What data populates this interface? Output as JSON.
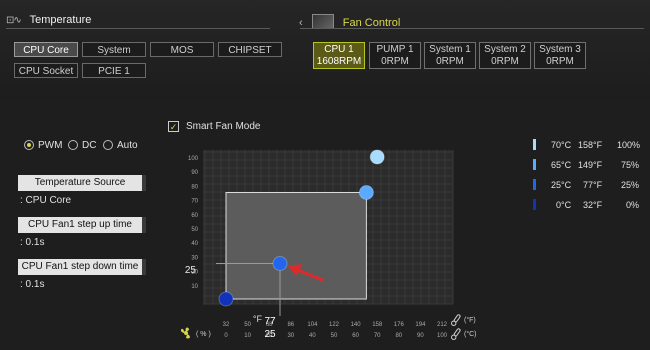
{
  "header": {
    "left_title": "Temperature",
    "left_icon": "temperature-monitor-icon",
    "right_title": "Fan Control",
    "right_icon": "fan-control-icon"
  },
  "sensors": [
    "CPU Core",
    "System",
    "MOS",
    "CHIPSET",
    "CPU Socket",
    "PCIE 1"
  ],
  "selected_sensor": "CPU Core",
  "fans": [
    {
      "name": "CPU 1",
      "rpm": "1608RPM"
    },
    {
      "name": "PUMP 1",
      "rpm": "0RPM"
    },
    {
      "name": "System 1",
      "rpm": "0RPM"
    },
    {
      "name": "System 2",
      "rpm": "0RPM"
    },
    {
      "name": "System 3",
      "rpm": "0RPM"
    }
  ],
  "selected_fan": "CPU 1",
  "mode_options": [
    "PWM",
    "DC",
    "Auto"
  ],
  "selected_mode": "PWM",
  "settings": {
    "temp_source_label": "Temperature Source",
    "temp_source_value": ": CPU Core",
    "step_up_label": "CPU Fan1 step up time",
    "step_up_value": ": 0.1s",
    "step_down_label": "CPU Fan1 step down time",
    "step_down_value": ": 0.1s"
  },
  "smart_fan": {
    "label": "Smart Fan Mode",
    "checked": true,
    "check_mark": "✓"
  },
  "legend": [
    {
      "c": "70°C",
      "f": "158°F",
      "pct": "100%",
      "color": "#a8dcff"
    },
    {
      "c": "65°C",
      "f": "149°F",
      "pct": "75%",
      "color": "#5aaaff"
    },
    {
      "c": "25°C",
      "f": "77°F",
      "pct": "25%",
      "color": "#2266ee"
    },
    {
      "c": "0°C",
      "f": "32°F",
      "pct": "0%",
      "color": "#1133bb"
    }
  ],
  "graph": {
    "y_ticks": [
      "100",
      "90",
      "80",
      "70",
      "60",
      "50",
      "40",
      "30",
      "20",
      "10"
    ],
    "f_ticks": [
      "32",
      "50",
      "68",
      "86",
      "104",
      "122",
      "140",
      "158",
      "176",
      "194",
      "212"
    ],
    "c_ticks": [
      "0",
      "10",
      "20",
      "30",
      "40",
      "50",
      "60",
      "70",
      "80",
      "90",
      "100"
    ],
    "f_unit": "(°F)",
    "c_unit": "(°C)",
    "pct_unit": "( % )",
    "highlight_temp_f": "77",
    "highlight_temp_c": "25",
    "highlight_pct": "25",
    "points": [
      {
        "temp_c": 0,
        "pct": 0,
        "color": "#1133bb"
      },
      {
        "temp_c": 25,
        "pct": 25,
        "color": "#2266ee"
      },
      {
        "temp_c": 65,
        "pct": 75,
        "color": "#5aaaff"
      },
      {
        "temp_c": 70,
        "pct": 100,
        "color": "#a8dcff"
      }
    ],
    "fan_icon": "fan-icon",
    "thermometer_icon": "thermometer-icon",
    "arrow": "red-pointer-arrow"
  }
}
